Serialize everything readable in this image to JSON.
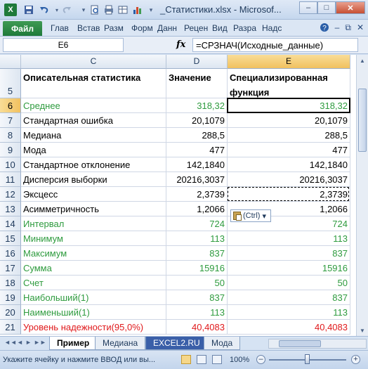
{
  "window": {
    "title": "_Статистики.xlsx - Microsof...",
    "minimize": "–",
    "maximize": "□",
    "close": "✕",
    "qat_icons": [
      "save-icon",
      "undo-icon",
      "redo-icon",
      "print-preview-icon",
      "quick-print-icon",
      "insert-table-icon",
      "chart-icon",
      "customize-qat-icon"
    ]
  },
  "ribbon": {
    "file_tab": "Файл",
    "tabs": [
      "Глав",
      "Встав",
      "Разм",
      "Форм",
      "Данн",
      "Рецен",
      "Вид",
      "Разра",
      "Надс"
    ],
    "right_icons": [
      "help-icon",
      "minimize-ribbon-icon",
      "restore-icon",
      "close-workbook-icon"
    ]
  },
  "formula_bar": {
    "name_box": "E6",
    "fx_label": "fx",
    "formula": "=СРЗНАЧ(Исходные_данные)"
  },
  "columns": [
    "C",
    "D",
    "E"
  ],
  "header_row": {
    "row": "5",
    "c": "Описательная статистика",
    "d": "Значение",
    "e": "Специализированная функция"
  },
  "rows": [
    {
      "row": "6",
      "label": "Среднее",
      "d": "318,32",
      "e": "318,32",
      "color": "green"
    },
    {
      "row": "7",
      "label": "Стандартная ошибка",
      "d": "20,1079",
      "e": "20,1079",
      "color": "black"
    },
    {
      "row": "8",
      "label": "Медиана",
      "d": "288,5",
      "e": "288,5",
      "color": "black"
    },
    {
      "row": "9",
      "label": "Мода",
      "d": "477",
      "e": "477",
      "color": "black"
    },
    {
      "row": "10",
      "label": "Стандартное отклонение",
      "d": "142,1840",
      "e": "142,1840",
      "color": "black"
    },
    {
      "row": "11",
      "label": "Дисперсия выборки",
      "d": "20216,3037",
      "e": "20216,3037",
      "color": "black"
    },
    {
      "row": "12",
      "label": "Эксцесс",
      "d": "2,3739",
      "e": "2,3739",
      "color": "black"
    },
    {
      "row": "13",
      "label": "Асимметричность",
      "d": "1,2066",
      "e": "1,2066",
      "color": "black"
    },
    {
      "row": "14",
      "label": "Интервал",
      "d": "724",
      "e": "724",
      "color": "green"
    },
    {
      "row": "15",
      "label": "Минимум",
      "d": "113",
      "e": "113",
      "color": "green"
    },
    {
      "row": "16",
      "label": "Максимум",
      "d": "837",
      "e": "837",
      "color": "green"
    },
    {
      "row": "17",
      "label": "Сумма",
      "d": "15916",
      "e": "15916",
      "color": "green"
    },
    {
      "row": "18",
      "label": "Счет",
      "d": "50",
      "e": "50",
      "color": "green"
    },
    {
      "row": "19",
      "label": "Наибольший(1)",
      "d": "837",
      "e": "837",
      "color": "green"
    },
    {
      "row": "20",
      "label": "Наименьший(1)",
      "d": "113",
      "e": "113",
      "color": "green"
    },
    {
      "row": "21",
      "label": "Уровень надежности(95,0%)",
      "d": "40,4083",
      "e": "40,4083",
      "color": "red"
    }
  ],
  "paste_options": {
    "label": "(Ctrl)",
    "arrow": "▾"
  },
  "sheet_tabs": [
    "Пример",
    "Медиана",
    "EXCEL2.RU",
    "Мода"
  ],
  "active_sheet": "Пример",
  "nav_arrows": [
    "◄◄",
    "◄",
    "►",
    "►►"
  ],
  "status": {
    "message": "Укажите ячейку и нажмите ВВОД или вы...",
    "zoom": "100%",
    "zoom_minus": "–",
    "zoom_plus": "+",
    "zoom_level_percent": 100
  },
  "colors": {
    "green": "#2e9b3e",
    "red": "#e0191b",
    "excel_green": "#1f7a3a",
    "selected_header": "#f1c15f"
  }
}
